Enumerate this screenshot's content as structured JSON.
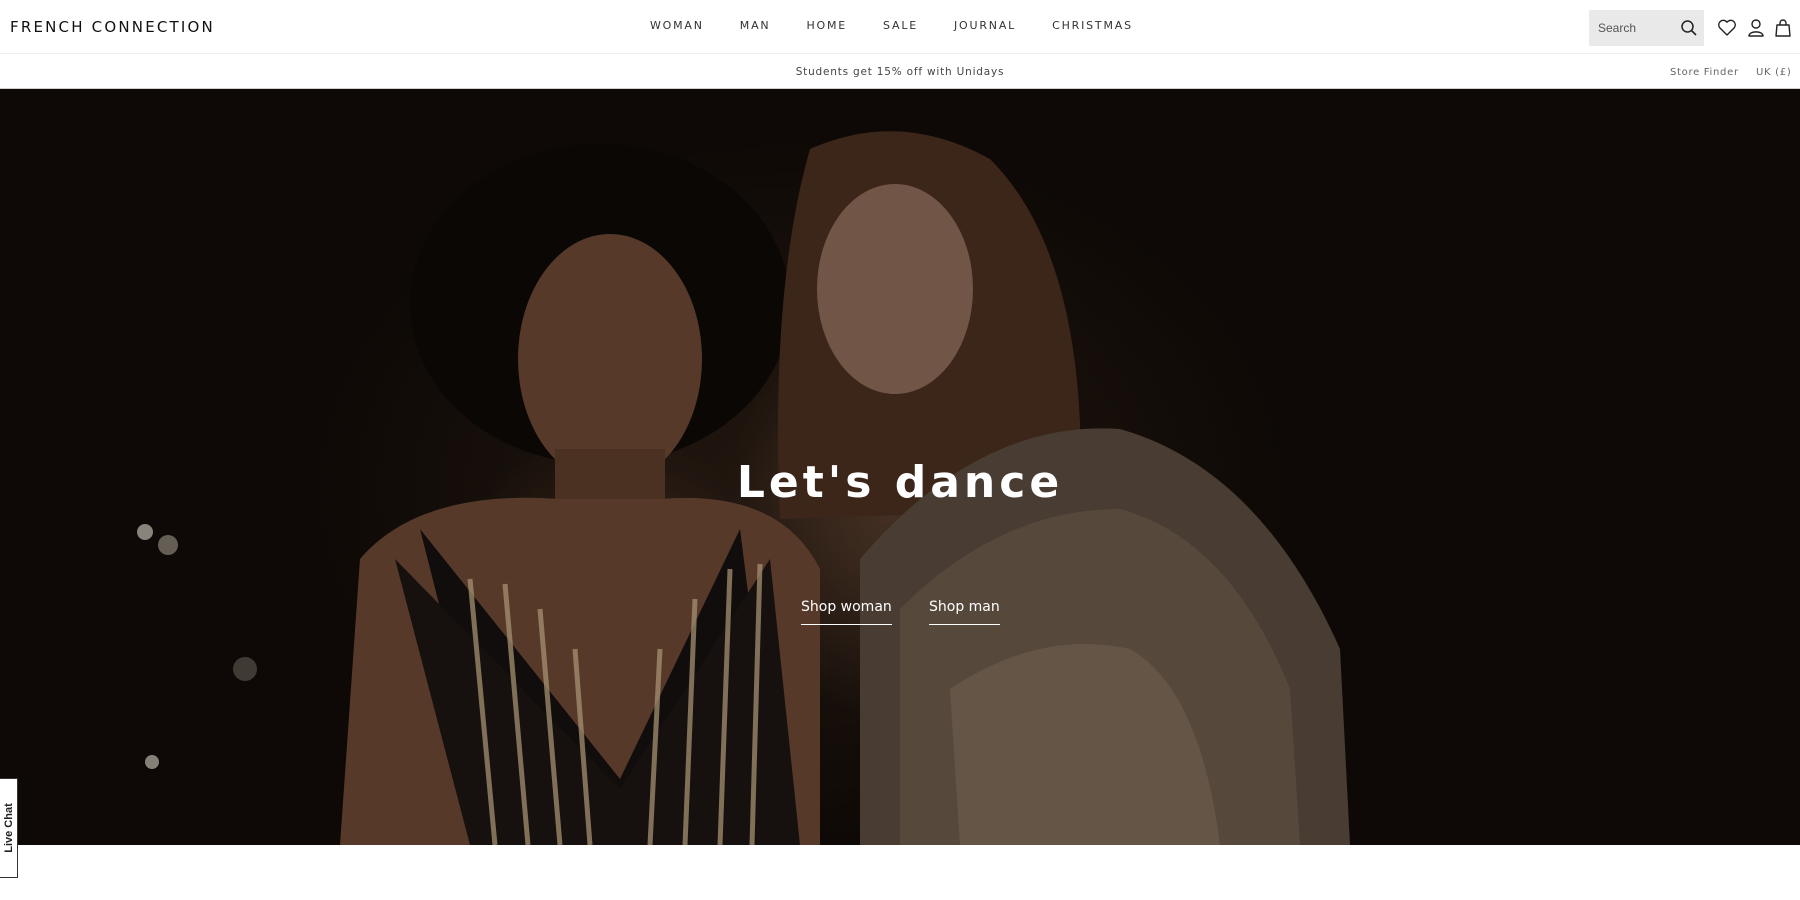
{
  "brand": {
    "logo_text": "FRENCH CONNECTION"
  },
  "nav": {
    "items": [
      {
        "label": "WOMAN"
      },
      {
        "label": "MAN"
      },
      {
        "label": "HOME"
      },
      {
        "label": "SALE"
      },
      {
        "label": "JOURNAL"
      },
      {
        "label": "CHRISTMAS"
      }
    ]
  },
  "search": {
    "placeholder": "Search",
    "value": "",
    "icon": "search-icon"
  },
  "header_icons": [
    "heart-icon",
    "user-icon",
    "bag-icon"
  ],
  "promo": {
    "text": "Students get 15% off with Unidays"
  },
  "utility": {
    "store_finder": "Store Finder",
    "region": "UK (£)"
  },
  "hero": {
    "title": "Let's dance",
    "cta_woman": "Shop woman",
    "cta_man": "Shop man"
  },
  "live_chat": {
    "label": "Live Chat"
  },
  "colors": {
    "text": "#222222",
    "search_bg": "#e9e9e9",
    "hero_bg": "#0d0907",
    "hero_text": "#ffffff"
  }
}
